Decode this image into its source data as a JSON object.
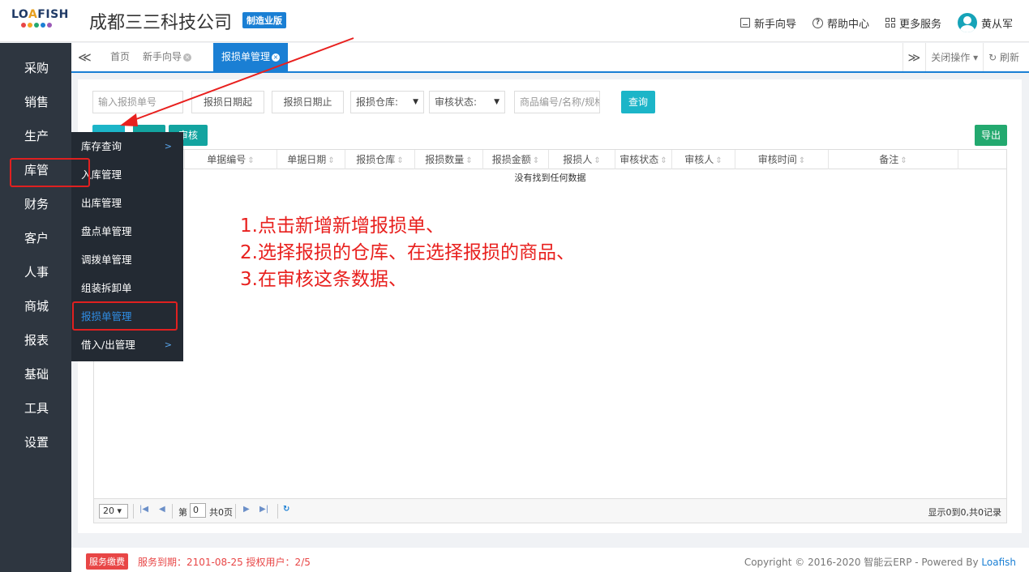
{
  "header": {
    "logo_text_a": "LO",
    "logo_text_b": "A",
    "logo_text_c": "FISH",
    "logo_dot_colors": [
      "#e84646",
      "#f5a623",
      "#23a96f",
      "#1a7fd4",
      "#9b59b6"
    ],
    "company": "成都三三科技公司",
    "edition": "制造业版",
    "links": {
      "guide": "新手向导",
      "help": "帮助中心",
      "more": "更多服务",
      "user": "黄从军"
    }
  },
  "sidebar": {
    "items": [
      {
        "label": "采购"
      },
      {
        "label": "销售"
      },
      {
        "label": "生产"
      },
      {
        "label": "库管"
      },
      {
        "label": "财务"
      },
      {
        "label": "客户"
      },
      {
        "label": "人事"
      },
      {
        "label": "商城"
      },
      {
        "label": "报表"
      },
      {
        "label": "基础"
      },
      {
        "label": "工具"
      },
      {
        "label": "设置"
      }
    ]
  },
  "submenu": {
    "items": [
      {
        "label": "库存查询",
        "chev": ">"
      },
      {
        "label": "入库管理",
        "chev": ""
      },
      {
        "label": "出库管理",
        "chev": ""
      },
      {
        "label": "盘点单管理",
        "chev": ""
      },
      {
        "label": "调拨单管理",
        "chev": ""
      },
      {
        "label": "组装拆卸单",
        "chev": ""
      },
      {
        "label": "报损单管理",
        "chev": ""
      },
      {
        "label": "借入/出管理",
        "chev": ">"
      }
    ]
  },
  "tabs": {
    "back": "≪",
    "items": [
      {
        "label": "首页",
        "closable": false
      },
      {
        "label": "新手向导",
        "closable": true
      },
      {
        "label": "报损单管理",
        "closable": true
      }
    ],
    "forward": "≫",
    "close_ops": "关闭操作",
    "refresh": "刷新"
  },
  "filters": {
    "order_no_placeholder": "输入报损单号",
    "date_start": "报损日期起",
    "date_end": "报损日期止",
    "warehouse": "报损仓库:",
    "audit_status": "审核状态:",
    "product_placeholder": "商品编号/名称/规格",
    "query": "查询"
  },
  "actions": {
    "audit": "审核",
    "export": "导出"
  },
  "table": {
    "columns": [
      "单据编号",
      "单据日期",
      "报损仓库",
      "报损数量",
      "报损金额",
      "报损人",
      "审核状态",
      "审核人",
      "审核时间",
      "备注"
    ],
    "empty": "没有找到任何数据"
  },
  "pager": {
    "page_size": "20",
    "page_label": "第",
    "page_value": "0",
    "total_pages": "共0页",
    "summary": "显示0到0,共0记录"
  },
  "annotation": {
    "lines": [
      "1.点击新增新增报损单、",
      "2.选择报损的仓库、在选择报损的商品、",
      "3.在审核这条数据、"
    ]
  },
  "footer": {
    "badge": "服务缴费",
    "expire": "服务到期：2101-08-25   授权用户：2/5",
    "copyright": "Copyright © 2016-2020 智能云ERP - Powered By ",
    "brand": "Loafish"
  },
  "colors": {
    "primary": "#1a7fd4",
    "nav_bg": "#2e3640",
    "submenu_bg": "#232a33",
    "teal_button": "#13a4a0",
    "query_button": "#1cb5c8",
    "export_button": "#23a96f",
    "annotation_red": "#e8201e"
  }
}
